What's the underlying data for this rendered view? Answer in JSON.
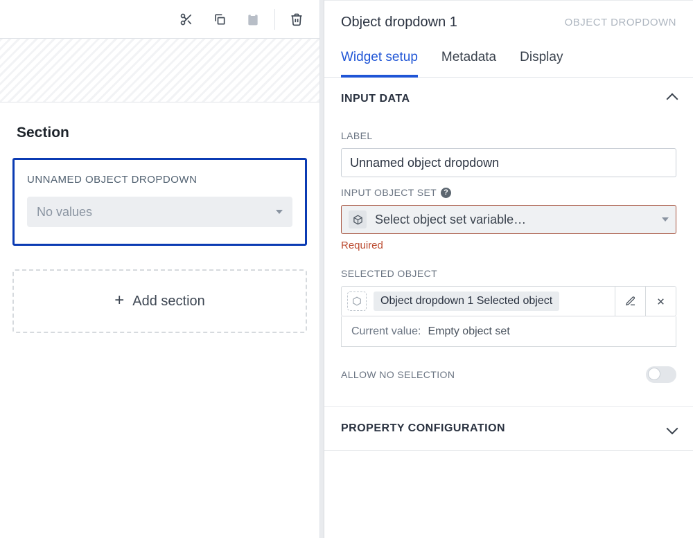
{
  "left": {
    "section_title": "Section",
    "widget": {
      "label": "UNNAMED OBJECT DROPDOWN",
      "placeholder": "No values"
    },
    "add_section_label": "Add section"
  },
  "right": {
    "title": "Object dropdown 1",
    "type_label": "OBJECT DROPDOWN",
    "tabs": [
      "Widget setup",
      "Metadata",
      "Display"
    ],
    "active_tab": 0,
    "input_data": {
      "heading": "INPUT DATA",
      "label_lbl": "LABEL",
      "label_value": "Unnamed object dropdown",
      "input_set_lbl": "INPUT OBJECT SET",
      "input_set_placeholder": "Select object set variable…",
      "input_set_error": "Required",
      "selected_lbl": "SELECTED OBJECT",
      "selected_value": "Object dropdown 1 Selected object",
      "current_value_lbl": "Current value:",
      "current_value": "Empty object set",
      "allow_none_lbl": "ALLOW NO SELECTION",
      "allow_none": false
    },
    "property_config": {
      "heading": "PROPERTY CONFIGURATION",
      "expanded": false
    }
  }
}
